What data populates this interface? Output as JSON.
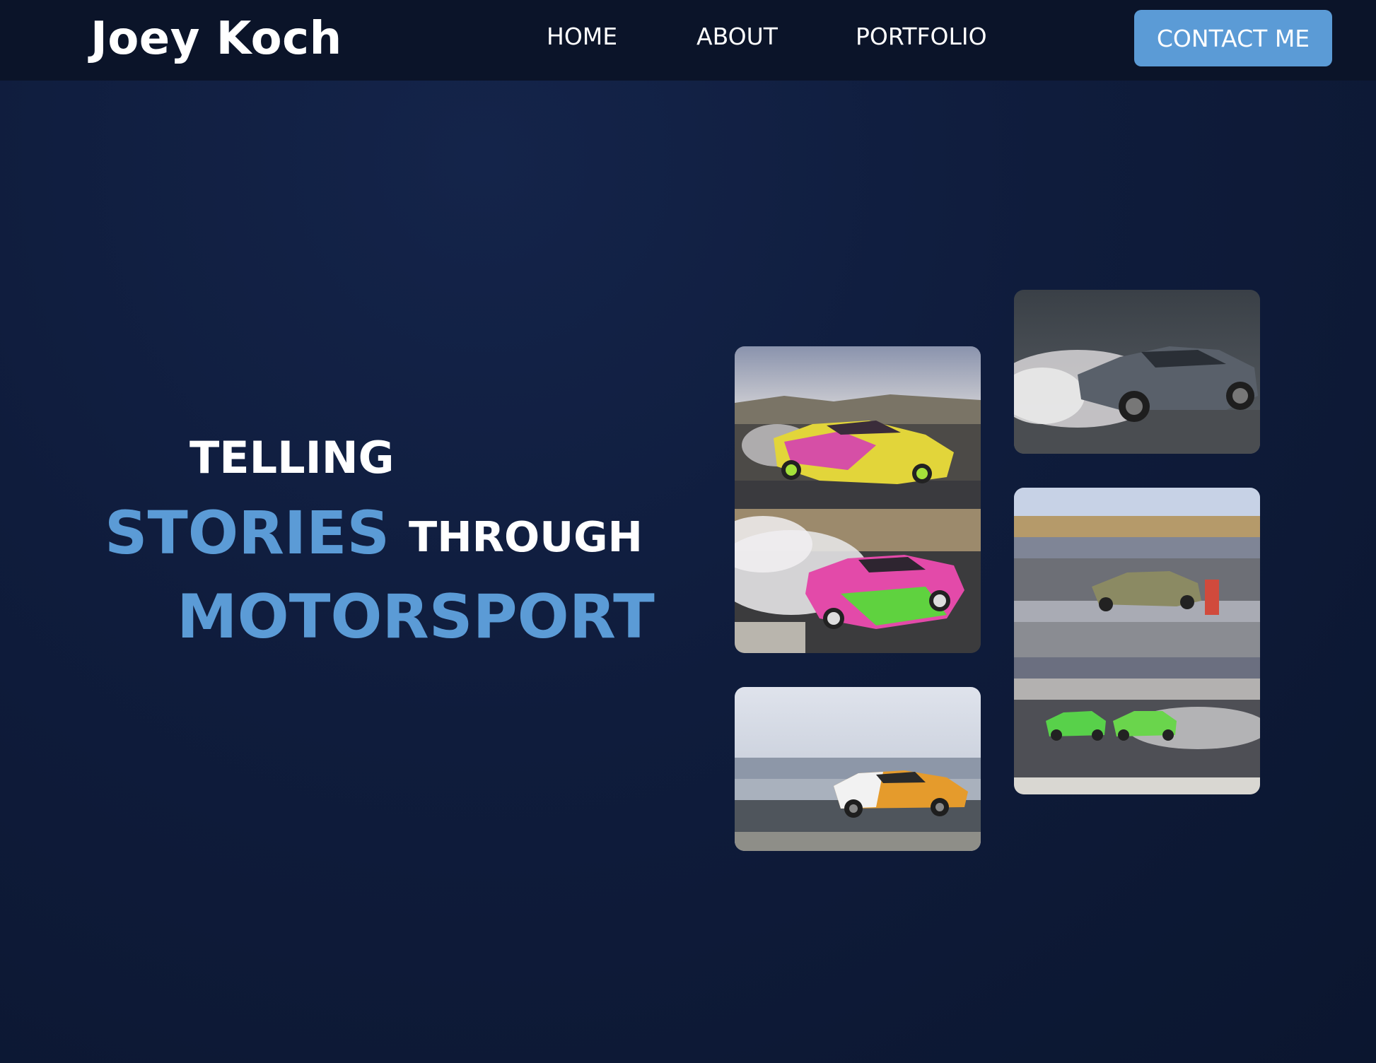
{
  "brand": {
    "name": "Joey Koch"
  },
  "nav": {
    "home": "HOME",
    "about": "ABOUT",
    "portfolio": "PORTFOLIO",
    "contact": "CONTACT ME"
  },
  "hero": {
    "line1": "TELLING",
    "line2_a": "STORIES",
    "line2_b": "THROUGH",
    "line3": "MOTORSPORT"
  },
  "colors": {
    "accent": "#5b9bd6",
    "nav_bg": "#0b1429",
    "page_bg": "#0f1c3c",
    "text": "#ffffff"
  },
  "gallery": [
    {
      "subject": "two drift cars, yellow-pink and pink-green, with tire smoke"
    },
    {
      "subject": "grey sports car drifting with smoke, motion blur"
    },
    {
      "subject": "gold car and two green cars drifting on track, motion blur"
    },
    {
      "subject": "orange and yellow race car panning shot"
    }
  ]
}
